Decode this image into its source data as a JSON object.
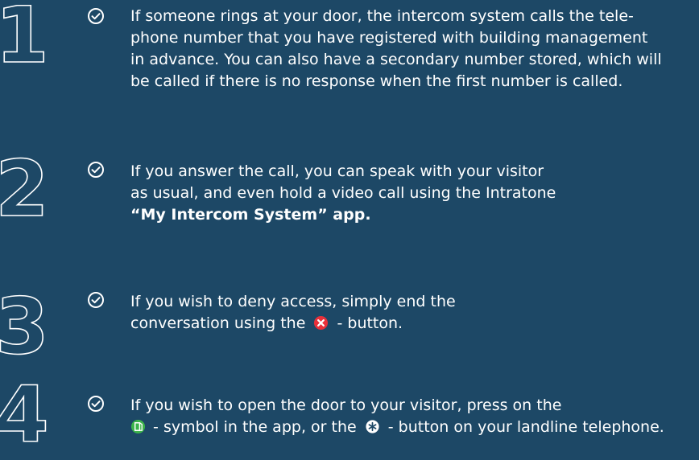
{
  "steps": [
    {
      "number": "1",
      "lines": [
        "If someone rings at your door, the intercom system calls the tele-",
        "phone number that you have registered with building management",
        "in advance. You can also have a secondary number stored, which will",
        "be called if there is no response when the first number is called."
      ]
    },
    {
      "number": "2",
      "lines": [
        "If you answer the call, you can speak with your visitor",
        "as usual, and even hold a video call using the Intratone"
      ],
      "bold_line": "“My Intercom System” app."
    },
    {
      "number": "3",
      "line1": "If you wish to deny access, simply end the",
      "line2_before": "conversation using the",
      "line2_after": "- button."
    },
    {
      "number": "4",
      "line1": "If you wish to open the door to your visitor, press on the",
      "line2_part1": "- symbol in the app, or the",
      "line2_part2": "- button on your landline telephone."
    }
  ],
  "icons": {
    "check": "check-circle-icon",
    "deny": "red-x-icon",
    "open": "green-door-icon",
    "key": "star-key-icon"
  },
  "colors": {
    "background": "#1d4866",
    "text": "#ffffff",
    "deny": "#e8303a",
    "open": "#3cb44a"
  }
}
